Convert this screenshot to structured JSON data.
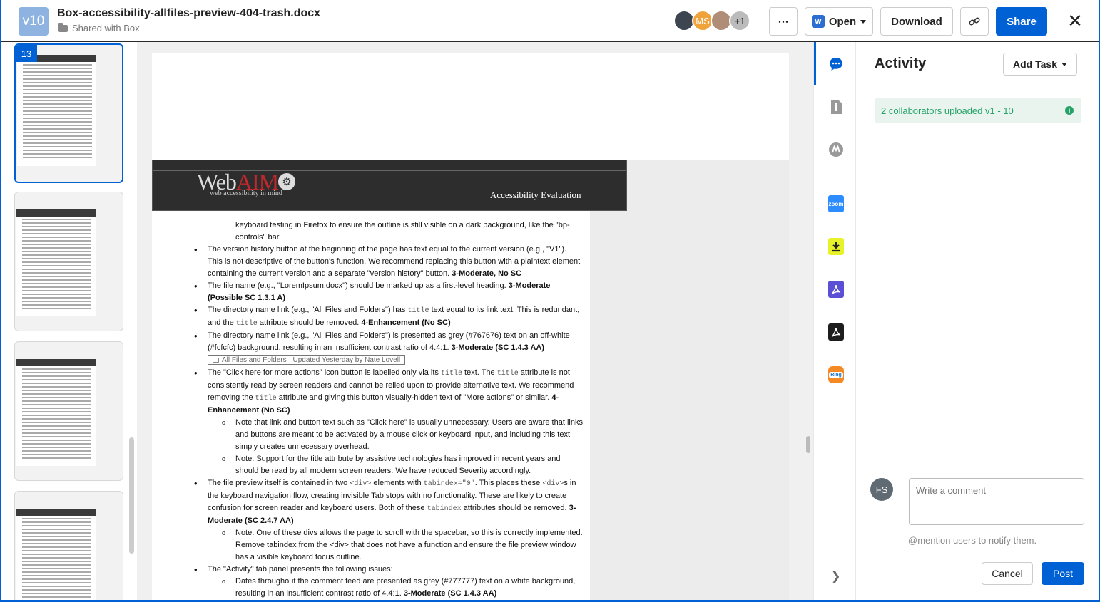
{
  "header": {
    "version_badge": "v10",
    "file_name": "Box-accessibility-allfiles-preview-404-trash.docx",
    "shared_text": "Shared with Box",
    "collaborators": [
      "",
      "MS",
      "",
      "+1"
    ],
    "more_label": "⋯",
    "open_label": "Open",
    "download_label": "Download",
    "share_label": "Share",
    "close_label": "✕"
  },
  "thumbnails": {
    "current_page": "13"
  },
  "document": {
    "logo_web": "Web",
    "logo_aim": "AIM",
    "logo_tagline": "web accessibility in mind",
    "header_title": "Accessibility Evaluation",
    "continuation": "keyboard testing in Firefox to ensure the outline is still visible on a dark background, like the \"bp-controls\" bar.",
    "bullets": [
      {
        "text": "The version history button at the beginning of the page has text equal to the current version (e.g., \"V1\"). This is not descriptive of the button's function. We recommend replacing this button with a plaintext element containing the current version and a separate \"version history\" button.",
        "rating": "3-Moderate, No SC"
      },
      {
        "text": "The file name (e.g., \"LoremIpsum.docx\") should be marked up as a first-level heading.",
        "rating": "3-Moderate (Possible SC 1.3.1 A)"
      },
      {
        "text_a": "The directory name link (e.g., \"All Files and Folders\") has",
        "code_a": "title",
        "text_b": "text equal to its link text. This is redundant, and the",
        "code_b": "title",
        "text_c": "attribute should be removed.",
        "rating": "4-Enhancement (No SC)"
      },
      {
        "text": "The directory name link (e.g., \"All Files and Folders\") is presented as grey (#767676) text on an off-white (#fcfcfc) background, resulting in an insufficient contrast ratio of 4.4:1.",
        "rating": "3-Moderate (SC 1.4.3 AA)",
        "crumb": "All Files and Folders · Updated Yesterday by Nate Lovell"
      },
      {
        "text_a": "The \"Click here for more actions\" icon button is labelled only via its",
        "code_a": "title",
        "text_b": "text. The",
        "code_b": "title",
        "text_c": "attribute is not consistently read by screen readers and cannot be relied upon to provide alternative text. We recommend removing the",
        "code_c": "title",
        "text_d": "attribute and giving this button visually-hidden text of \"More actions\" or similar.",
        "rating": "4-Enhancement (No SC)"
      },
      {
        "text_a": "The file preview itself is contained in two",
        "code_a": "<div>",
        "text_b": "elements with",
        "code_b": "tabindex=\"0\"",
        "text_c": ". This places these",
        "code_c": "<div>",
        "text_d": "s in the keyboard navigation flow, creating invisible Tab stops with no functionality. These are likely to create confusion for screen reader and keyboard users. Both of these",
        "code_d": "tabindex",
        "text_e": "attributes should be removed.",
        "rating": "3-Moderate (SC 2.4.7 AA)"
      },
      {
        "text": "The \"Activity\" tab panel presents the following issues:"
      }
    ],
    "sub_click_here": "Note that link and button text such as \"Click here\" is usually unnecessary. Users are aware that links and buttons are meant to be activated by a mouse click or keyboard input, and including this text simply creates unnecessary overhead.",
    "sub_title_support": "Note: Support for the title attribute by assistive technologies has improved in recent years and should be read by all modern screen readers. We have reduced Severity accordingly.",
    "sub_divs": "Note: One of these divs allows the page to scroll with the spacebar, so this is correctly implemented. Remove tabindex from the <div> that does not have a function and ensure the file preview window has a visible keyboard focus outline.",
    "sub_dates": "Dates throughout the comment feed are presented as grey (#777777) text on a white background, resulting in an insufficient contrast ratio of 4.4:1.",
    "sub_dates_rating": "3-Moderate (SC 1.4.3 AA)"
  },
  "sidebar_icons": [
    "activity-icon",
    "details-icon",
    "skills-icon",
    "zoom-icon",
    "download-app-icon",
    "acrobat-icon",
    "acrobat-dark-icon",
    "ring-icon"
  ],
  "sidebar_app_labels": {
    "zoom": "zoom",
    "ring": "Ring"
  },
  "activity": {
    "title": "Activity",
    "add_task_label": "Add Task",
    "collab_notice": "2 collaborators uploaded v1 - 10",
    "commenter_initials": "FS",
    "comment_placeholder": "Write a comment",
    "mention_hint": "@mention users to notify them.",
    "cancel_label": "Cancel",
    "post_label": "Post"
  },
  "colors": {
    "accent": "#0061d5",
    "collab_bg": "#e9f4ee",
    "collab_text": "#26a269"
  }
}
